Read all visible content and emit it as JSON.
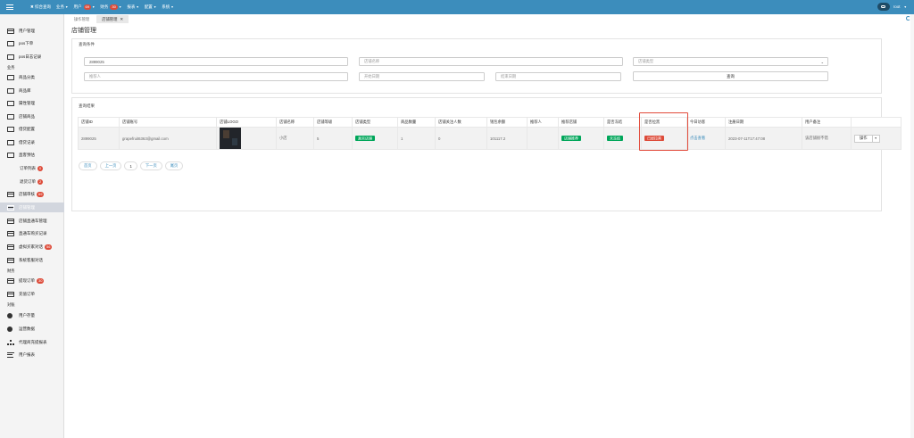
{
  "topbar": {
    "nav": [
      {
        "label": "✖ 综合查询",
        "badge": "",
        "caret": false
      },
      {
        "label": "业务",
        "badge": "",
        "caret": true
      },
      {
        "label": "用户",
        "badge": "69",
        "caret": true
      },
      {
        "label": "财务",
        "badge": "30",
        "caret": true
      },
      {
        "label": "报表",
        "badge": "",
        "caret": true
      },
      {
        "label": "配置",
        "badge": "",
        "caret": true
      },
      {
        "label": "系统",
        "badge": "",
        "caret": true
      }
    ],
    "user": "root"
  },
  "sidebar": {
    "items": [
      {
        "label": "用户管理",
        "badge": "",
        "type": "item",
        "icon": "card-icon"
      },
      {
        "label": "pos下单",
        "badge": "",
        "type": "item",
        "icon": "book-icon"
      },
      {
        "label": "pos日志记录",
        "badge": "",
        "type": "item",
        "icon": "book-icon"
      },
      {
        "label": "业务",
        "badge": "",
        "type": "group",
        "icon": ""
      },
      {
        "label": "商品分类",
        "badge": "",
        "type": "item",
        "icon": "laptop-icon"
      },
      {
        "label": "商品库",
        "badge": "",
        "type": "item",
        "icon": "book-icon"
      },
      {
        "label": "属性管理",
        "badge": "",
        "type": "item",
        "icon": "book-icon"
      },
      {
        "label": "店铺商品",
        "badge": "",
        "type": "item",
        "icon": "book-icon"
      },
      {
        "label": "借贷配置",
        "badge": "",
        "type": "item",
        "icon": "book-icon"
      },
      {
        "label": "借贷记录",
        "badge": "",
        "type": "item",
        "icon": "book-icon"
      },
      {
        "label": "直客预估",
        "badge": "",
        "type": "item",
        "icon": "users-icon"
      },
      {
        "label": "订单列表",
        "badge": "0",
        "type": "sub",
        "icon": ""
      },
      {
        "label": "退货订单",
        "badge": "2",
        "type": "sub",
        "icon": ""
      },
      {
        "label": "店铺审核",
        "badge": "69",
        "type": "item",
        "icon": "card-icon"
      },
      {
        "label": "店铺管理",
        "badge": "",
        "type": "active",
        "icon": "card-icon"
      },
      {
        "label": "店铺直通车管理",
        "badge": "",
        "type": "item",
        "icon": "card-icon"
      },
      {
        "label": "直通车购买记录",
        "badge": "",
        "type": "item",
        "icon": "card-icon"
      },
      {
        "label": "虚拟买家对话",
        "badge": "56",
        "type": "item",
        "icon": "card-icon"
      },
      {
        "label": "系统客服对话",
        "badge": "",
        "type": "item",
        "icon": "card-icon"
      },
      {
        "label": "财务",
        "badge": "",
        "type": "group",
        "icon": ""
      },
      {
        "label": "提现订单",
        "badge": "30",
        "type": "item",
        "icon": "card-icon"
      },
      {
        "label": "充值订单",
        "badge": "",
        "type": "item",
        "icon": "card-icon"
      },
      {
        "label": "对账",
        "badge": "",
        "type": "group",
        "icon": ""
      },
      {
        "label": "用户存量",
        "badge": "",
        "type": "item",
        "icon": "pie-chart-icon"
      },
      {
        "label": "运营数据",
        "badge": "",
        "type": "item",
        "icon": "pie-chart-icon"
      },
      {
        "label": "代理商充提报表",
        "badge": "",
        "type": "item",
        "icon": "sitemap-icon"
      },
      {
        "label": "用户报表",
        "badge": "",
        "type": "item",
        "icon": "list-icon"
      }
    ]
  },
  "tabs": [
    {
      "label": "操作管理",
      "active": false
    },
    {
      "label": "店铺管理",
      "active": true
    }
  ],
  "page": {
    "title": "店铺管理"
  },
  "query": {
    "title": "查询条件",
    "store_id": "2899025",
    "store_name_ph": "店铺名称",
    "store_type_ph": "店铺类型",
    "referrer_ph": "推荐人",
    "start_date_ph": "开始日期",
    "end_date_ph": "结束日期",
    "query_button": "查询"
  },
  "results": {
    "title": "查询结果",
    "columns": [
      "店铺ID",
      "店铺账号",
      "店铺LOGO",
      "店铺名称",
      "店铺等级",
      "店铺类型",
      "商品数量",
      "店铺关注人数",
      "钱包余额",
      "推荐人",
      "推荐店铺",
      "是否冻结",
      "是否拉黑",
      "今日访客",
      "注册日期",
      "用户备注",
      ""
    ],
    "rows": [
      {
        "store_id": "2899025",
        "account": "grapefruit6363@gmail.com",
        "name": "小店",
        "level": "5",
        "type": "真实店铺",
        "goods": "1",
        "followers": "0",
        "balance": "101117.2",
        "referrer": "",
        "recommended": "店铺推荐",
        "frozen": "未冻结",
        "blacklisted": "已经拉黑",
        "visitors": "点击查看",
        "register_date": "2023-07-11T17:47:08",
        "remark": "该店铺很不错",
        "action": "操作"
      }
    ]
  },
  "pager": {
    "first": "首页",
    "prev": "上一页",
    "current": "1",
    "next": "下一页",
    "last": "尾页"
  },
  "colors": {
    "primary": "#3c8dbc",
    "danger": "#dd4b39",
    "success": "#00a65a",
    "highlight": "#e24a3a"
  }
}
